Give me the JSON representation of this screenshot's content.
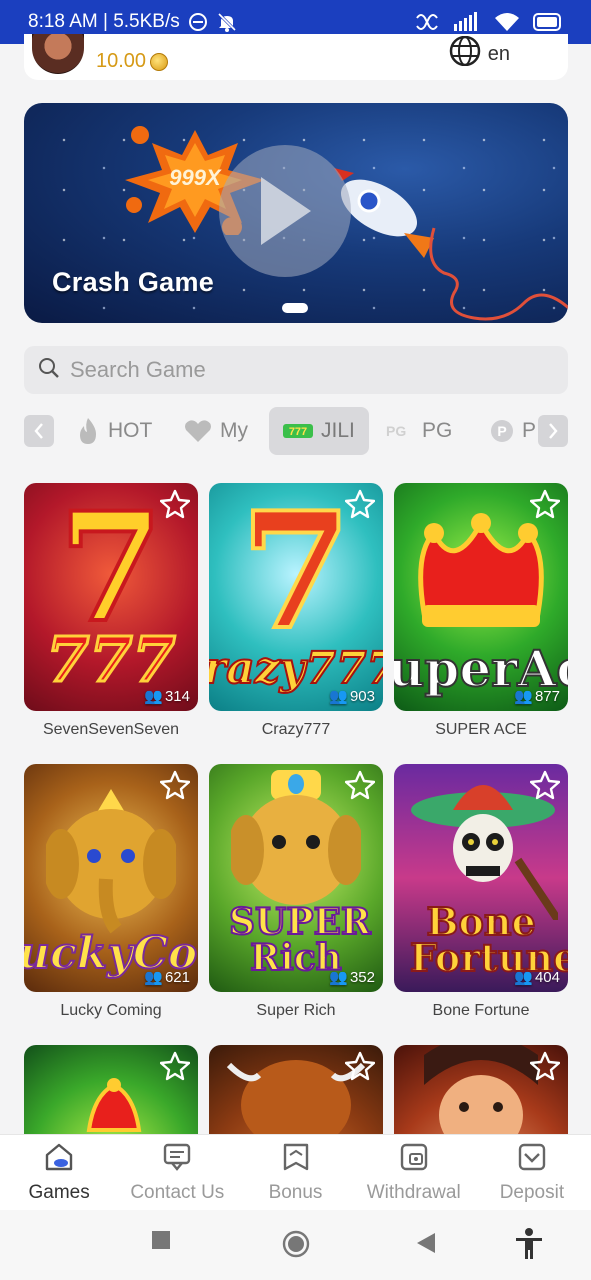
{
  "status_bar": {
    "time_speed": "8:18 AM | 5.5KB/s",
    "bg_color": "#1b3fbf"
  },
  "account": {
    "balance": "10.00",
    "language": "en",
    "balance_color": "#d69a16"
  },
  "banner": {
    "title": "Crash Game",
    "multiplier_text": "999X"
  },
  "search": {
    "placeholder": "Search Game"
  },
  "tabs": {
    "items": [
      {
        "label": "HOT",
        "icon": "flame-icon"
      },
      {
        "label": "My",
        "icon": "heart-icon"
      },
      {
        "label": "JILI",
        "icon": "jili-logo-icon",
        "badge": "777"
      },
      {
        "label": "PG",
        "icon": "pg-logo-icon",
        "badge": "PG"
      },
      {
        "label": "P",
        "icon": "p-logo-icon",
        "badge": "P"
      }
    ],
    "active": "JILI"
  },
  "games": [
    {
      "name": "SevenSevenSeven",
      "players": "314",
      "art_text": "777"
    },
    {
      "name": "Crazy777",
      "players": "903",
      "art_text": "razy777"
    },
    {
      "name": "SUPER ACE",
      "players": "877",
      "art_text": "uperAce"
    },
    {
      "name": "Lucky Coming",
      "players": "621",
      "art_text": "uckyComin"
    },
    {
      "name": "Super Rich",
      "players": "352",
      "art_text": "SUPER Rich"
    },
    {
      "name": "Bone Fortune",
      "players": "404",
      "art_text": "Bone Fortune"
    },
    {
      "name": "",
      "players": ""
    },
    {
      "name": "",
      "players": ""
    },
    {
      "name": "",
      "players": ""
    }
  ],
  "bottom_nav": {
    "items": [
      {
        "label": "Games",
        "icon": "games-icon"
      },
      {
        "label": "Contact Us",
        "icon": "contact-icon"
      },
      {
        "label": "Bonus",
        "icon": "bonus-icon"
      },
      {
        "label": "Withdrawal",
        "icon": "withdrawal-icon"
      },
      {
        "label": "Deposit",
        "icon": "deposit-icon"
      }
    ],
    "active": "Games"
  }
}
